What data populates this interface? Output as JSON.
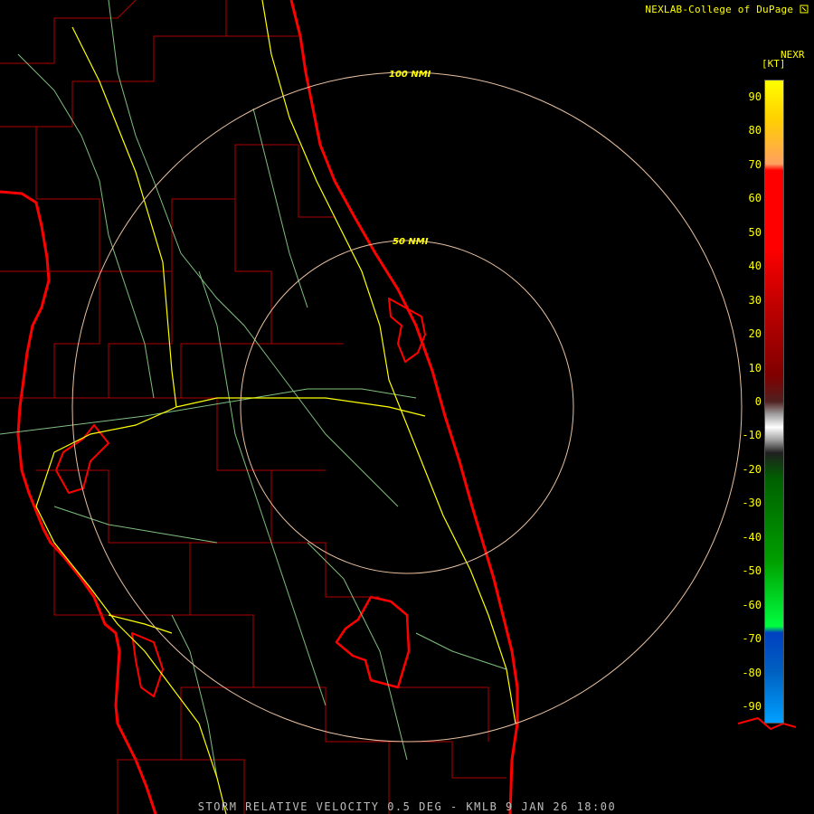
{
  "header": {
    "credit": "NEXLAB-College of DuPage",
    "logo_icon": "cod-logo-icon"
  },
  "legend": {
    "title": "NEXR",
    "unit": "[KT]",
    "ticks": [
      "90",
      "80",
      "70",
      "60",
      "50",
      "40",
      "30",
      "20",
      "10",
      "0",
      "-10",
      "-20",
      "-30",
      "-40",
      "-50",
      "-60",
      "-70",
      "-80",
      "-90"
    ],
    "range": [
      -95,
      95
    ]
  },
  "rings": {
    "inner_label": "50 NMI",
    "outer_label": "100 NMI"
  },
  "footer": {
    "caption": "STORM RELATIVE VELOCITY 0.5 DEG - KMLB 9 JAN 26 18:00"
  },
  "colors": {
    "background": "#000000",
    "coastline": "#ff0000",
    "county_lines": "#b00000",
    "highways": "#ffff00",
    "roads": "#7fbf7f",
    "range_rings": "#e8c0a0",
    "label": "#ffff00",
    "footer_text": "#bdbdbd"
  }
}
